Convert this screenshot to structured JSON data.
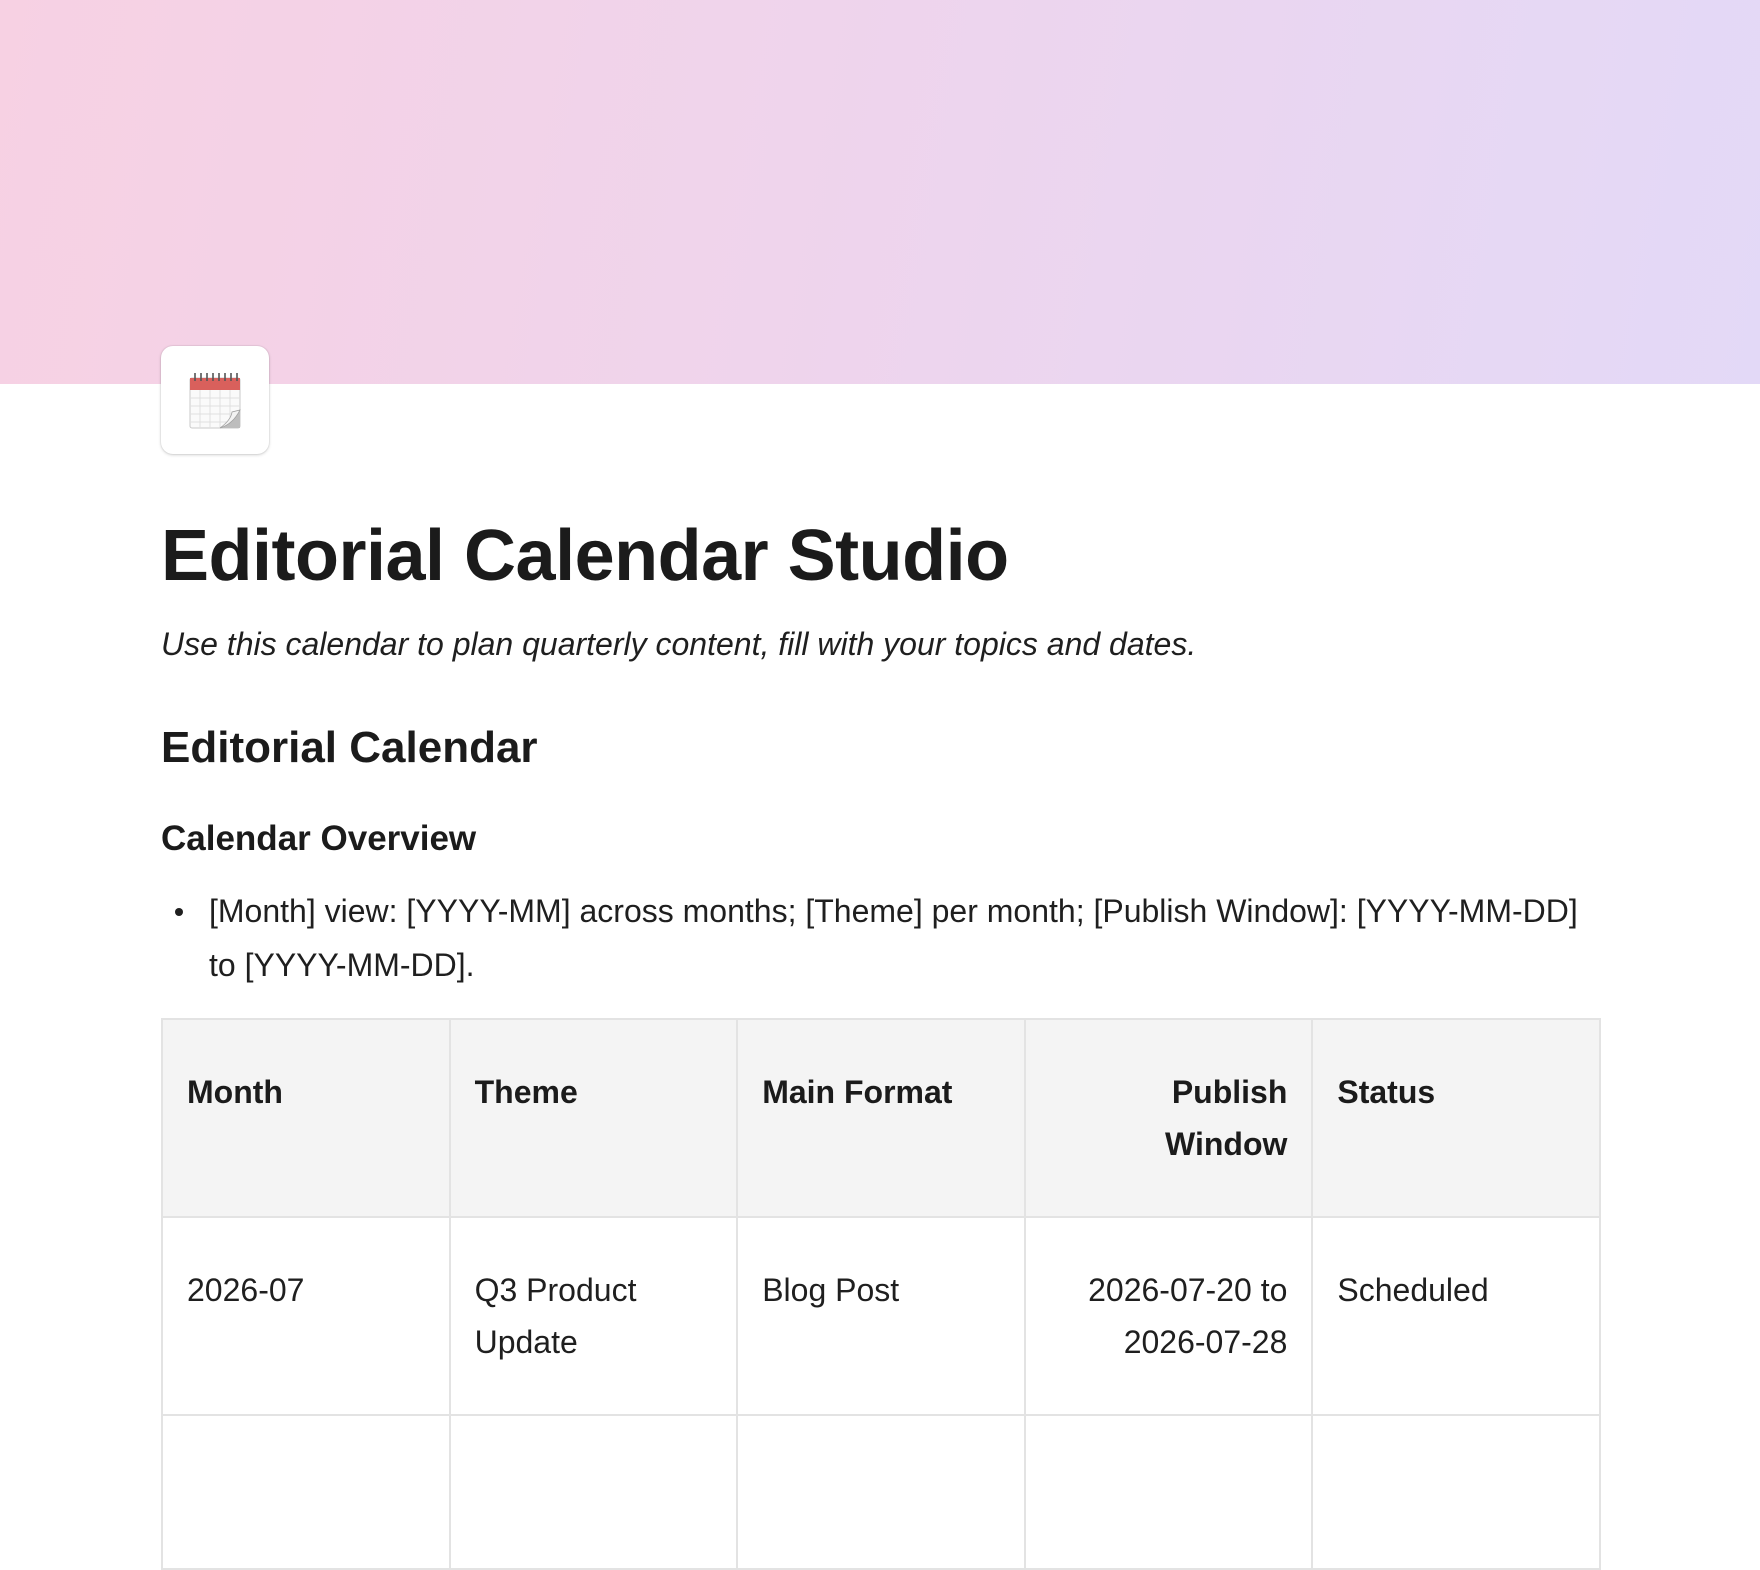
{
  "page": {
    "title": "Editorial Calendar Studio",
    "subtitle": "Use this calendar to plan quarterly content, fill with your topics and dates.",
    "icon": "calendar-icon",
    "cover_colors": [
      "#f7d1e3",
      "#efd4ec",
      "#e3d9f7"
    ]
  },
  "section": {
    "heading": "Editorial Calendar",
    "subheading": "Calendar Overview",
    "bullets": [
      "[Month] view: [YYYY-MM] across months; [Theme] per month; [Publish Window]: [YYYY-MM-DD] to [YYYY-MM-DD]."
    ]
  },
  "table": {
    "headers": [
      "Month",
      "Theme",
      "Main Format",
      "Publish Window",
      "Status"
    ],
    "rows": [
      [
        "2026-07",
        "Q3 Product Update",
        "Blog Post",
        "2026-07-20 to 2026-07-28",
        "Scheduled"
      ],
      [
        "",
        "",
        "",
        "",
        ""
      ]
    ]
  }
}
